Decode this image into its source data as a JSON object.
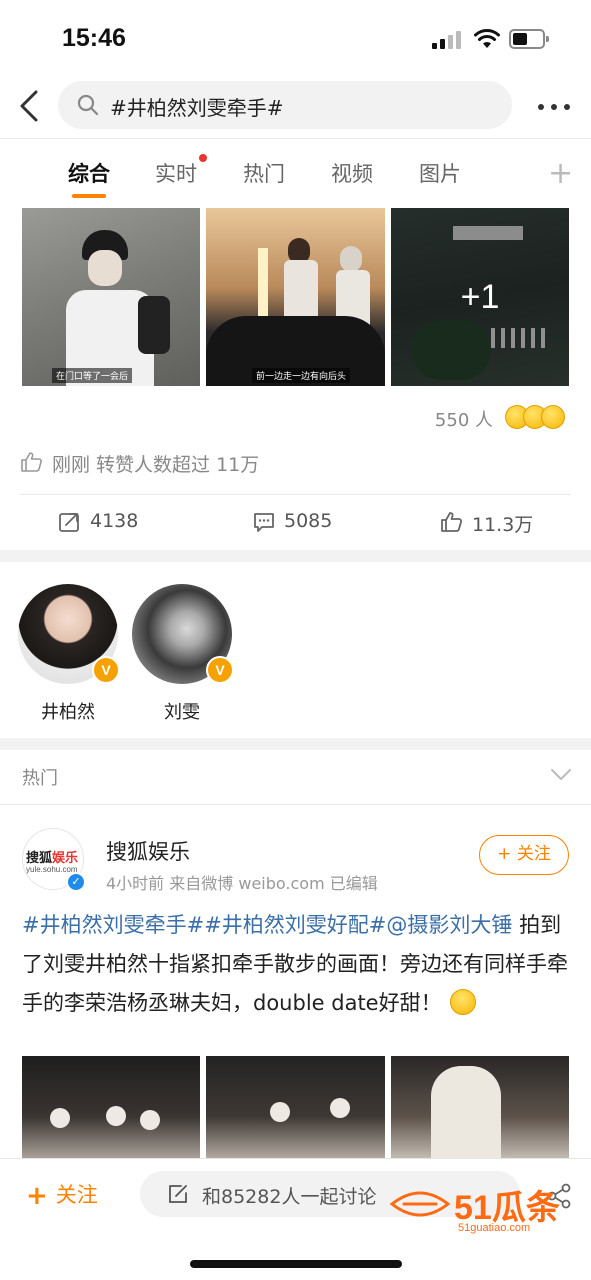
{
  "status_bar": {
    "time": "15:46"
  },
  "search": {
    "query": "#井柏然刘雯牵手#"
  },
  "tabs": [
    {
      "label": "综合"
    },
    {
      "label": "实时"
    },
    {
      "label": "热门"
    },
    {
      "label": "视频"
    },
    {
      "label": "图片"
    }
  ],
  "top_post": {
    "image_captions": [
      "在门口等了一会后",
      "前一边走一边有向后头"
    ],
    "more_images_label": "+1",
    "reaction_count": "550 人",
    "hot_notice": "刚刚 转赞人数超过 11万",
    "actions": {
      "repost": "4138",
      "comment": "5085",
      "like": "11.3万"
    }
  },
  "users": [
    {
      "name": "井柏然",
      "badge": "V"
    },
    {
      "name": "刘雯",
      "badge": "V"
    }
  ],
  "hot_section": {
    "title": "热门"
  },
  "post": {
    "avatar_logo_a": "搜狐",
    "avatar_logo_b": "娱乐",
    "avatar_url": "yule.sohu.com",
    "author": "搜狐娱乐",
    "meta": "4小时前  来自微博 weibo.com  已编辑",
    "follow_label": "+ 关注",
    "tag1": "#井柏然刘雯牵手#",
    "tag2": "#井柏然刘雯好配#",
    "mention": "@摄影刘大锤",
    "text": "拍到了刘雯井柏然十指紧扣牵手散步的画面！旁边还有同样手牵手的李荣浩杨丞琳夫妇，double date好甜！"
  },
  "bottom_bar": {
    "follow_label": "关注",
    "follow_plus": "+",
    "discuss_label": "和85282人一起讨论"
  },
  "watermark": {
    "text": "51瓜条",
    "url": "51guatiao.com"
  },
  "colors": {
    "accent": "#ff8200",
    "link": "#3b6fa8",
    "badge": "#f5a100",
    "verified": "#1f8ceb"
  }
}
